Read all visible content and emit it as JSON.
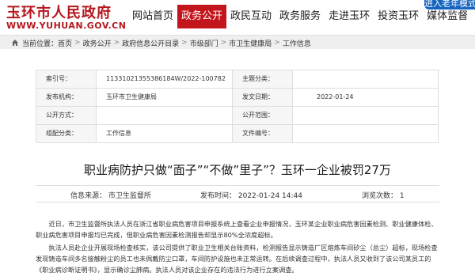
{
  "site": {
    "name_cn": "玉环市人民政府",
    "name_en": "WWW.YUHUAN.GOV.CN"
  },
  "nav": [
    {
      "label": "网站首页",
      "active": false
    },
    {
      "label": "政务公开",
      "active": true
    },
    {
      "label": "政民互动",
      "active": false
    },
    {
      "label": "政务服务",
      "active": false
    },
    {
      "label": "走进玉环",
      "active": false
    },
    {
      "label": "投资玉环",
      "active": false
    },
    {
      "label": "媒体监督",
      "active": false
    }
  ],
  "elder_button": "进入老年模式",
  "breadcrumb": {
    "prefix": "当前位置：",
    "items": [
      "首页",
      "政务公开",
      "政府信息公开目录",
      "市级部门",
      "市卫生健康局",
      "工作信息"
    ],
    "separator": ">"
  },
  "meta": {
    "index_label": "索引号：",
    "index_value": "11331021355386184W/2022-100782",
    "subject_label": "主题分类：",
    "subject_value": "",
    "org_label": "发布机构：",
    "org_value": "玉环市卫生健康局",
    "date_label": "发文日期：",
    "date_value": "2022-01-24",
    "method_label": "公开方式：",
    "method_value": "",
    "scope_label": "公开范围：",
    "scope_value": "",
    "category_label": "组配分类：",
    "category_value": "工作信息",
    "docno_label": "文件编号：",
    "docno_value": ""
  },
  "article": {
    "title": "职业病防护只做“面子”“不做”里子”？玉环一企业被罚27万",
    "source": "信息来源： 市卫生监督所",
    "time": "发布时间： 2022-01-24 14:44",
    "views": "浏览次数： 1",
    "paragraphs": [
      "近日，市卫生监督所执法人员在浙江省职业病危害项目申报系统上查看企业申报情况，玉环某企业职业病危害因素检测、职业健康体检、职业病危害项目申报均已完成，但职业病危害因素检测报告却显示80%全浓度超标。",
      "执法人员赴企业开展现场检查核实，该公司提供了职业卫生相关台账资料，检测报告显示铸造厂区熔炼车间矽尘（总尘）超标，现场检查发现铸造车间多名接触粉尘的员工也未佩戴防尘口罩，车间防护设施也未正常运转。在后续调查过程中，执法人员又收到了该公司某员工的《职业病诊断证明书》，显示确诊尘肺病。执法人员对该企业存在的违法行为进行立案调查。"
    ]
  },
  "colors": {
    "brand_red": "#c3161c",
    "elder_blue": "#1565c0"
  }
}
